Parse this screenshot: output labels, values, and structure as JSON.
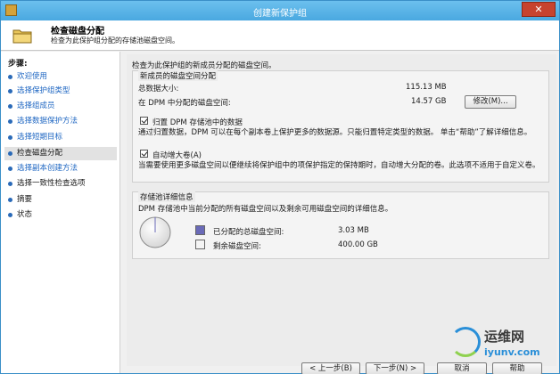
{
  "window": {
    "title": "创建新保护组",
    "close_label": "✕"
  },
  "header": {
    "title": "检查磁盘分配",
    "subtitle": "检查为此保护组分配的存储池磁盘空间。"
  },
  "sidebar": {
    "title": "步骤:",
    "items": [
      {
        "label": "欢迎使用",
        "state": "done"
      },
      {
        "label": "选择保护组类型",
        "state": "done"
      },
      {
        "label": "选择组成员",
        "state": "done"
      },
      {
        "label": "选择数据保护方法",
        "state": "done"
      },
      {
        "label": "选择短期目标",
        "state": "done"
      },
      {
        "label": "检查磁盘分配",
        "state": "current"
      },
      {
        "label": "选择副本创建方法",
        "state": "done"
      },
      {
        "label": "选择一致性检查选项",
        "state": "pending"
      },
      {
        "label": "摘要",
        "state": "pending"
      },
      {
        "label": "状态",
        "state": "pending"
      }
    ]
  },
  "main": {
    "intro": "检查为此保护组的新成员分配的磁盘空间。",
    "allocation": {
      "group_title": "新成员的磁盘空间分配",
      "total_label": "总数据大小:",
      "total_value": "115.13 MB",
      "dpm_label": "在 DPM 中分配的磁盘空间:",
      "dpm_value": "14.57 GB",
      "modify_button": "修改(M)...",
      "colocate_checkbox": "归置 DPM 存储池中的数据",
      "colocate_desc": "通过归置数据，DPM 可以在每个副本卷上保护更多的数据源。只能归置特定类型的数据。 单击“帮助”了解详细信息。",
      "autogrow_checkbox": "自动增大卷(A)",
      "autogrow_desc": "当需要使用更多磁盘空间以便继续将保护组中的项保护指定的保持期时，自动增大分配的卷。此选项不适用于自定义卷。"
    },
    "storage_pool": {
      "group_title": "存储池详细信息",
      "desc": "DPM 存储池中当前分配的所有磁盘空间以及剩余可用磁盘空间的详细信息。",
      "allocated_label": "已分配的总磁盘空间:",
      "allocated_value": "3.03 MB",
      "free_label": "剩余磁盘空间:",
      "free_value": "400.00 GB",
      "allocated_color": "#6a6ab8",
      "free_color": "#f4f4f4"
    }
  },
  "footer": {
    "back_button": "< 上一步(B)",
    "next_button": "下一步(N) >",
    "cancel_button": "取消",
    "help_button": "帮助"
  },
  "watermark": {
    "text_cn": "运维网",
    "text_url": "iyunv.com"
  }
}
